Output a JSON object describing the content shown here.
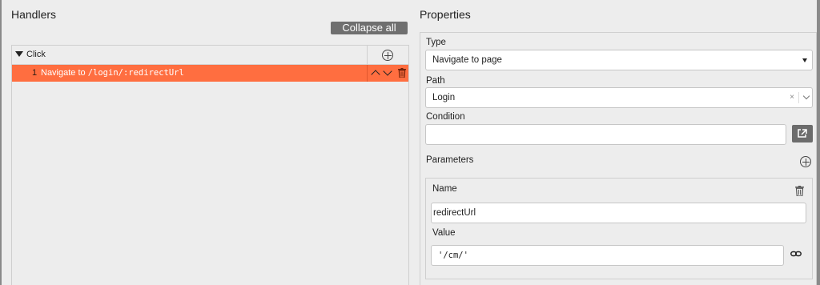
{
  "handlers": {
    "title": "Handlers",
    "collapse_label": "Collapse all",
    "event": {
      "label": "Click"
    },
    "actions": [
      {
        "index": "1",
        "label": "Navigate to",
        "path": "/login/:redirectUrl"
      }
    ]
  },
  "properties": {
    "title": "Properties",
    "type": {
      "label": "Type",
      "value": "Navigate to page"
    },
    "path": {
      "label": "Path",
      "value": "Login",
      "clear": "×"
    },
    "condition": {
      "label": "Condition",
      "value": ""
    },
    "parameters": {
      "label": "Parameters",
      "items": [
        {
          "name_label": "Name",
          "name_value": "redirectUrl",
          "value_label": "Value",
          "value_value": "'/cm/'"
        }
      ]
    }
  },
  "colors": {
    "selected_row": "#ff6e40",
    "button_bg": "#6f6f6f"
  },
  "icons": [
    "triangle-down-icon",
    "add-circle-icon",
    "chevron-up-icon",
    "chevron-down-icon",
    "trash-icon",
    "external-link-icon",
    "link-icon"
  ]
}
